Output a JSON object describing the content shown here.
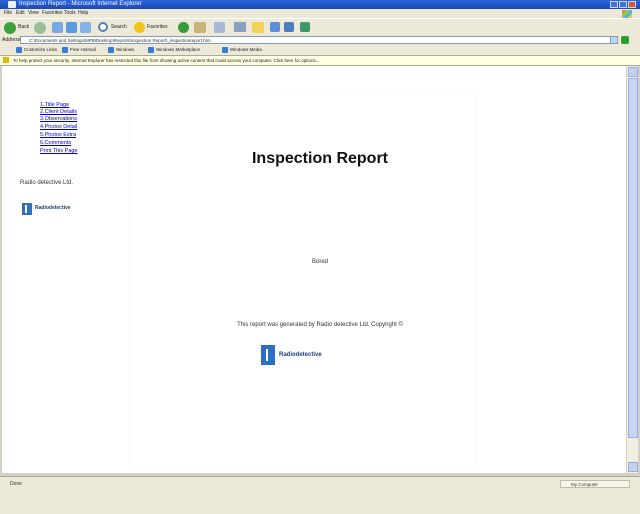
{
  "window": {
    "title": "Inspection Report - Microsoft Internet Explorer"
  },
  "menu": [
    "File",
    "Edit",
    "View",
    "Favorites",
    "Tools",
    "Help"
  ],
  "toolbar": {
    "back_label": "Back",
    "search_label": "Search",
    "favorites_label": "Favorites"
  },
  "address": {
    "label": "Address",
    "url": "C:\\Documents and Settings\\MPB\\Desktop\\Reports\\Inspection Report\\_inspectionreport.htm",
    "go_label": "Go"
  },
  "links": [
    "Customize Links",
    "Free Hotmail",
    "Windows",
    "Windows Marketplace",
    "Windows Media"
  ],
  "infobar": {
    "text": "To help protect your security, Internet Explorer has restricted this file from showing active content that could access your computer. Click here for options..."
  },
  "sidebar": {
    "links": [
      "1.Title Page",
      "2.Client Details",
      "3.Observations",
      "4.Photos Detail",
      "5.Photos Extra",
      "6.Comments",
      "Print This Page"
    ],
    "company": "Radio detective Ltd.",
    "logo_name": "Radiodetective"
  },
  "report": {
    "title": "Inspection Report",
    "client": "Bored",
    "copyright": "This report was generated by Radio detective Ltd. Copyright ©",
    "logo_name": "Radiodetective"
  },
  "status": {
    "left": "Done",
    "zone": "My Computer"
  }
}
